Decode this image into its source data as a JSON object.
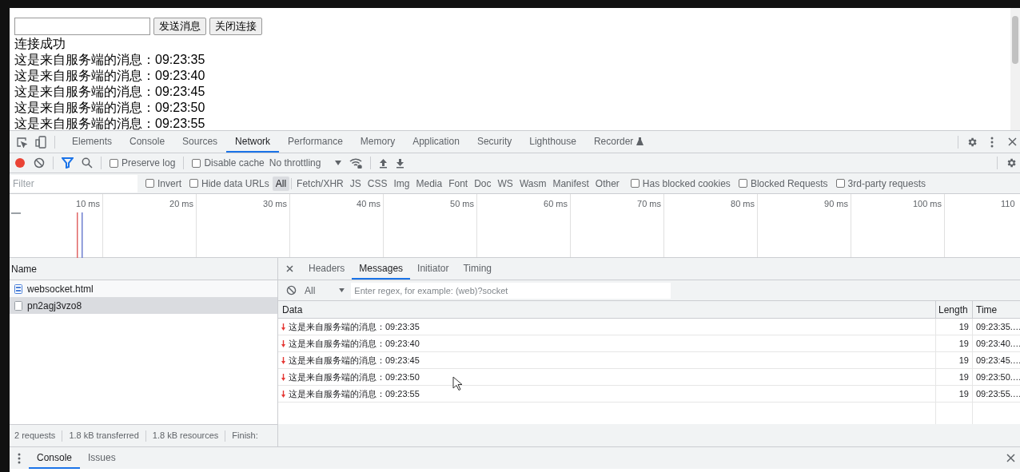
{
  "page": {
    "buttons": [
      "发送消息",
      "关闭连接"
    ],
    "lines": [
      "连接成功",
      "这是来自服务端的消息：09:23:35",
      "这是来自服务端的消息：09:23:40",
      "这是来自服务端的消息：09:23:45",
      "这是来自服务端的消息：09:23:50",
      "这是来自服务端的消息：09:23:55"
    ]
  },
  "devtools": {
    "tabs": [
      {
        "label": "Elements",
        "selected": false
      },
      {
        "label": "Console",
        "selected": false
      },
      {
        "label": "Sources",
        "selected": false
      },
      {
        "label": "Network",
        "selected": true
      },
      {
        "label": "Performance",
        "selected": false
      },
      {
        "label": "Memory",
        "selected": false
      },
      {
        "label": "Application",
        "selected": false
      },
      {
        "label": "Security",
        "selected": false
      },
      {
        "label": "Lighthouse",
        "selected": false
      },
      {
        "label": "Recorder",
        "selected": false
      }
    ],
    "toolbar": {
      "recording": true,
      "preserve_log": {
        "label": "Preserve log",
        "checked": false
      },
      "disable_cache": {
        "label": "Disable cache",
        "checked": false
      },
      "throttling": "No throttling"
    },
    "filter": {
      "placeholder": "Filter",
      "invert": {
        "label": "Invert",
        "checked": false
      },
      "hide_data_urls": {
        "label": "Hide data URLs",
        "checked": false
      },
      "types": [
        {
          "label": "All",
          "selected": true
        },
        {
          "label": "Fetch/XHR",
          "selected": false
        },
        {
          "label": "JS",
          "selected": false
        },
        {
          "label": "CSS",
          "selected": false
        },
        {
          "label": "Img",
          "selected": false
        },
        {
          "label": "Media",
          "selected": false
        },
        {
          "label": "Font",
          "selected": false
        },
        {
          "label": "Doc",
          "selected": false
        },
        {
          "label": "WS",
          "selected": false
        },
        {
          "label": "Wasm",
          "selected": false
        },
        {
          "label": "Manifest",
          "selected": false
        },
        {
          "label": "Other",
          "selected": false
        }
      ],
      "extra": [
        {
          "label": "Has blocked cookies",
          "checked": false
        },
        {
          "label": "Blocked Requests",
          "checked": false
        },
        {
          "label": "3rd-party requests",
          "checked": false
        }
      ]
    },
    "timeline": {
      "ticks": [
        "10 ms",
        "20 ms",
        "30 ms",
        "40 ms",
        "50 ms",
        "60 ms",
        "70 ms",
        "80 ms",
        "90 ms",
        "100 ms",
        "110"
      ]
    },
    "requests": {
      "column": "Name",
      "items": [
        {
          "name": "websocket.html",
          "kind": "document",
          "selected": false
        },
        {
          "name": "pn2agj3vzo8",
          "kind": "other",
          "selected": true
        }
      ]
    },
    "detail": {
      "tabs": [
        {
          "label": "Headers",
          "selected": false
        },
        {
          "label": "Messages",
          "selected": true
        },
        {
          "label": "Initiator",
          "selected": false
        },
        {
          "label": "Timing",
          "selected": false
        }
      ],
      "message_filter": {
        "value": "All",
        "placeholder": "Enter regex, for example: (web)?socket"
      },
      "columns": [
        "Data",
        "Length",
        "Time"
      ],
      "messages": [
        {
          "data": "这是来自服务端的消息：09:23:35",
          "length": "19",
          "time": "09:23:35.…"
        },
        {
          "data": "这是来自服务端的消息：09:23:40",
          "length": "19",
          "time": "09:23:40.…"
        },
        {
          "data": "这是来自服务端的消息：09:23:45",
          "length": "19",
          "time": "09:23:45.…"
        },
        {
          "data": "这是来自服务端的消息：09:23:50",
          "length": "19",
          "time": "09:23:50.…"
        },
        {
          "data": "这是来自服务端的消息：09:23:55",
          "length": "19",
          "time": "09:23:55.…"
        }
      ]
    },
    "summary": [
      "2 requests",
      "1.8 kB transferred",
      "1.8 kB resources",
      "Finish:"
    ],
    "drawer_tabs": [
      {
        "label": "Console",
        "selected": true
      },
      {
        "label": "Issues",
        "selected": false
      }
    ]
  }
}
